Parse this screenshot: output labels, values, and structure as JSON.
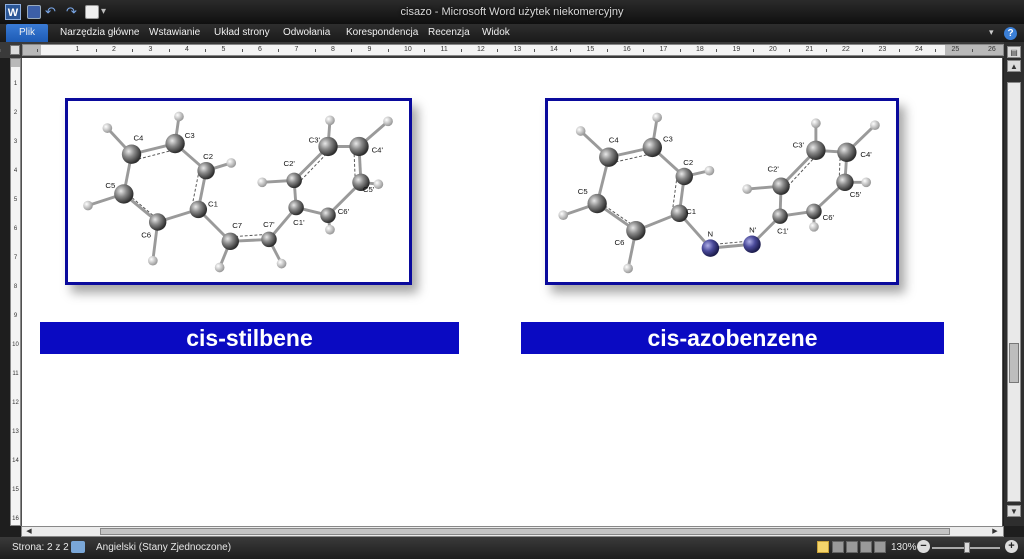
{
  "window": {
    "title": "cisazo - Microsoft Word użytek niekomercyjny"
  },
  "quick_access": {
    "word_icon": "W",
    "save_icon": "save-icon",
    "undo_icon": "undo-icon",
    "redo_icon": "redo-icon",
    "new_icon": "new-document-icon"
  },
  "ribbon": {
    "file_tab": "Plik",
    "tabs": [
      "Narzędzia główne",
      "Wstawianie",
      "Układ strony",
      "Odwołania",
      "Korespondencja",
      "Recenzja",
      "Widok"
    ],
    "help_icon": "?"
  },
  "ruler": {
    "numbers": [
      "2",
      "1",
      "1",
      "2",
      "3",
      "4",
      "5",
      "6",
      "7",
      "8",
      "9",
      "10",
      "11",
      "12",
      "13",
      "14",
      "15",
      "16",
      "17",
      "18",
      "19",
      "20",
      "21",
      "22",
      "23",
      "24",
      "25",
      "26"
    ],
    "vertical_numbers": [
      "1",
      "2",
      "3",
      "4",
      "5",
      "6",
      "7",
      "8",
      "9",
      "10",
      "11",
      "12",
      "13",
      "14",
      "15",
      "16"
    ]
  },
  "document": {
    "molecules": [
      {
        "name": "cis-stilbene",
        "atom_labels": [
          "C4",
          "C3",
          "C2",
          "C5",
          "C1",
          "C6",
          "C7",
          "C7'",
          "C2'",
          "C3'",
          "C4'",
          "C5'",
          "C6'",
          "C1'"
        ]
      },
      {
        "name": "cis-azobenzene",
        "atom_labels": [
          "C4",
          "C3",
          "C2",
          "C5",
          "C1",
          "C6",
          "N",
          "N'",
          "C2'",
          "C3'",
          "C4'",
          "C5'",
          "C6'",
          "C1'"
        ]
      }
    ]
  },
  "statusbar": {
    "page": "Strona: 2 z 2",
    "language": "Angielski (Stany Zjednoczone)",
    "zoom": "130%",
    "zoom_minus": "−",
    "zoom_plus": "+"
  },
  "colors": {
    "label_bar": "#0a0ac2",
    "frame": "#0a0a9c",
    "carbon": "#7d7d7d",
    "nitrogen": "#4a4a9a",
    "hydrogen": "#f0f0f0"
  }
}
